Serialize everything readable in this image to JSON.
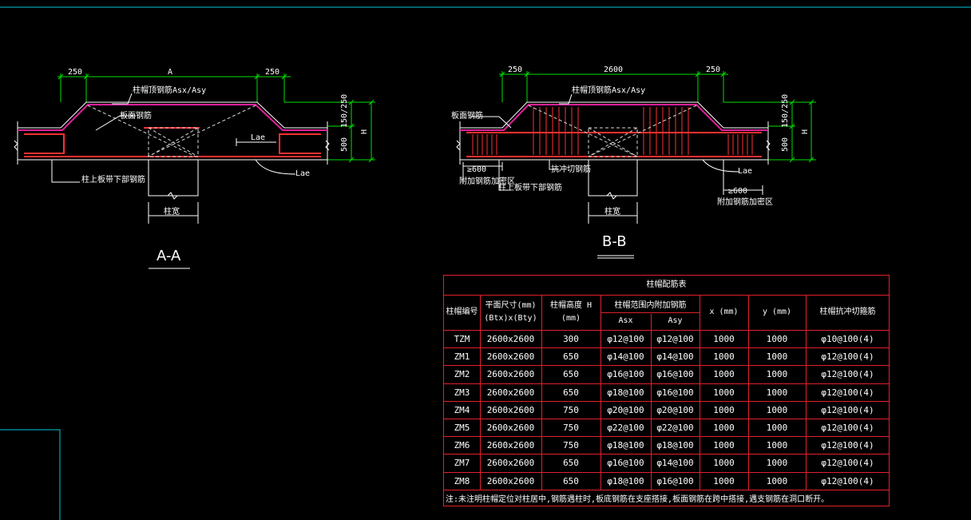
{
  "section_aa": {
    "title": "A-A",
    "dims": {
      "left": "250",
      "middle": "A",
      "right": "250",
      "h_top": "150/250",
      "h_bottom": "500",
      "h": "H"
    },
    "labels": {
      "top_bar": "柱帽顶钢筋Asx/Asy",
      "slab_bar": "板面钢筋",
      "col_bar": "柱上板带下部钢筋",
      "lae1": "Lae",
      "lae2": "Lae",
      "col_width": "柱宽"
    }
  },
  "section_bb": {
    "title": "B-B",
    "dims": {
      "left": "250",
      "middle": "2600",
      "right": "250",
      "h_top": "150/250",
      "h_bottom": "500",
      "h": "H"
    },
    "labels": {
      "top_bar": "柱帽顶钢筋Asx/Asy",
      "slab_top": "板面钢筋",
      "shear": "抗冲切钢筋",
      "ge600_left": "≥600",
      "reinf_left": "附加钢筋加密区",
      "col_bot": "柱上板带下部钢筋",
      "lae": "Lae",
      "ge600_right": "≥600",
      "reinf_right": "附加钢筋加密区",
      "col_width": "柱宽"
    }
  },
  "table": {
    "title": "柱帽配筋表",
    "headers": {
      "id": "柱帽编号",
      "plan_size_1": "平面尺寸(mm)",
      "plan_size_2": "(Btx)x(Bty)",
      "height_1": "柱帽高度 H",
      "height_2": "(mm)",
      "rebar_group": "柱帽范围内附加钢筋",
      "asx": "Asx",
      "asy": "Asy",
      "x": "x (mm)",
      "y": "y (mm)",
      "shear": "柱帽抗冲切箍筋"
    },
    "rows": [
      [
        "TZM",
        "2600x2600",
        "300",
        "φ12@100",
        "φ12@100",
        "1000",
        "1000",
        "φ10@100(4)"
      ],
      [
        "ZM1",
        "2600x2600",
        "650",
        "φ14@100",
        "φ14@100",
        "1000",
        "1000",
        "φ12@100(4)"
      ],
      [
        "ZM2",
        "2600x2600",
        "650",
        "φ16@100",
        "φ16@100",
        "1000",
        "1000",
        "φ12@100(4)"
      ],
      [
        "ZM3",
        "2600x2600",
        "650",
        "φ18@100",
        "φ16@100",
        "1000",
        "1000",
        "φ12@100(4)"
      ],
      [
        "ZM4",
        "2600x2600",
        "750",
        "φ20@100",
        "φ20@100",
        "1000",
        "1000",
        "φ12@100(4)"
      ],
      [
        "ZM5",
        "2600x2600",
        "750",
        "φ22@100",
        "φ22@100",
        "1000",
        "1000",
        "φ12@100(4)"
      ],
      [
        "ZM6",
        "2600x2600",
        "750",
        "φ18@100",
        "φ18@100",
        "1000",
        "1000",
        "φ12@100(4)"
      ],
      [
        "ZM7",
        "2600x2600",
        "650",
        "φ16@100",
        "φ14@100",
        "1000",
        "1000",
        "φ12@100(4)"
      ],
      [
        "ZM8",
        "2600x2600",
        "650",
        "φ18@100",
        "φ16@100",
        "1000",
        "1000",
        "φ12@100(4)"
      ]
    ],
    "note": "注:未注明柱帽定位对柱居中,钢筋遇柱时,板底钢筋在支座搭接,板面钢筋在跨中搭接,遇支钢筋在洞口断开。"
  },
  "colors": {
    "background": "#000000",
    "dimension": "#00e000",
    "outline": "#ffffff",
    "rebar": "#ff3030",
    "slab_top": "#e0209a",
    "label_leader": "#ffffff",
    "table_border": "#e0202c",
    "frame": "#00c8d8"
  }
}
